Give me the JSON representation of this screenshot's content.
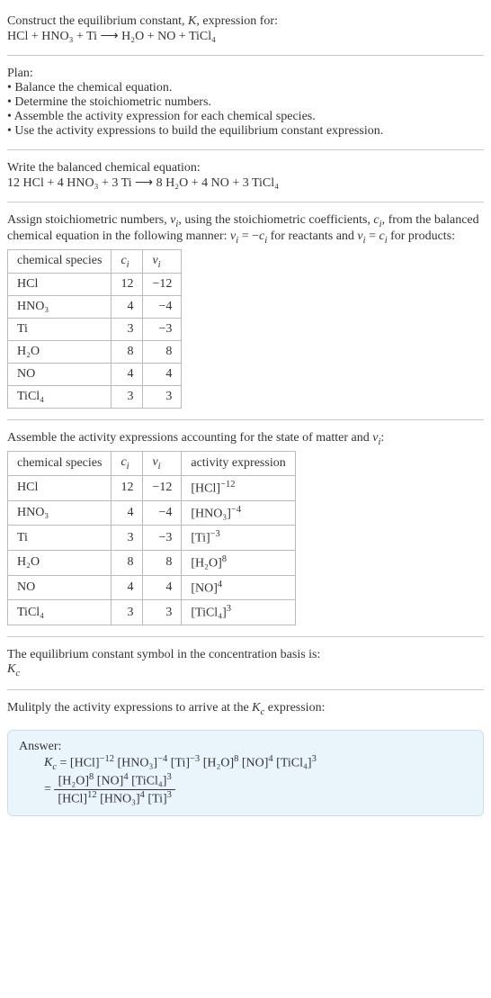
{
  "intro": {
    "line1": "Construct the equilibrium constant, K, expression for:",
    "eq": "HCl + HNO₃ + Ti ⟶ H₂O + NO + TiCl₄"
  },
  "plan": {
    "header": "Plan:",
    "items": [
      "• Balance the chemical equation.",
      "• Determine the stoichiometric numbers.",
      "• Assemble the activity expression for each chemical species.",
      "• Use the activity expressions to build the equilibrium constant expression."
    ]
  },
  "balanced": {
    "header": "Write the balanced chemical equation:",
    "eq": "12 HCl + 4 HNO₃ + 3 Ti ⟶ 8 H₂O + 4 NO + 3 TiCl₄"
  },
  "stoich_intro": {
    "text": "Assign stoichiometric numbers, νᵢ, using the stoichiometric coefficients, cᵢ, from the balanced chemical equation in the following manner: νᵢ = −cᵢ for reactants and νᵢ = cᵢ for products:"
  },
  "table1": {
    "headers": [
      "chemical species",
      "cᵢ",
      "νᵢ"
    ],
    "rows": [
      [
        "HCl",
        "12",
        "−12"
      ],
      [
        "HNO₃",
        "4",
        "−4"
      ],
      [
        "Ti",
        "3",
        "−3"
      ],
      [
        "H₂O",
        "8",
        "8"
      ],
      [
        "NO",
        "4",
        "4"
      ],
      [
        "TiCl₄",
        "3",
        "3"
      ]
    ]
  },
  "activity_intro": "Assemble the activity expressions accounting for the state of matter and νᵢ:",
  "table2": {
    "headers": [
      "chemical species",
      "cᵢ",
      "νᵢ",
      "activity expression"
    ],
    "rows": [
      {
        "species": "HCl",
        "c": "12",
        "v": "−12",
        "expr_base": "[HCl]",
        "expr_exp": "−12"
      },
      {
        "species": "HNO₃",
        "c": "4",
        "v": "−4",
        "expr_base": "[HNO₃]",
        "expr_exp": "−4"
      },
      {
        "species": "Ti",
        "c": "3",
        "v": "−3",
        "expr_base": "[Ti]",
        "expr_exp": "−3"
      },
      {
        "species": "H₂O",
        "c": "8",
        "v": "8",
        "expr_base": "[H₂O]",
        "expr_exp": "8"
      },
      {
        "species": "NO",
        "c": "4",
        "v": "4",
        "expr_base": "[NO]",
        "expr_exp": "4"
      },
      {
        "species": "TiCl₄",
        "c": "3",
        "v": "3",
        "expr_base": "[TiCl₄]",
        "expr_exp": "3"
      }
    ]
  },
  "symbol": {
    "line1": "The equilibrium constant symbol in the concentration basis is:",
    "line2": "K_c"
  },
  "multiply": "Mulitply the activity expressions to arrive at the K_c expression:",
  "answer": {
    "label": "Answer:",
    "line1_prefix": "K_c = ",
    "line1_terms": [
      {
        "base": "[HCl]",
        "exp": "−12"
      },
      {
        "base": "[HNO₃]",
        "exp": "−4"
      },
      {
        "base": "[Ti]",
        "exp": "−3"
      },
      {
        "base": "[H₂O]",
        "exp": "8"
      },
      {
        "base": "[NO]",
        "exp": "4"
      },
      {
        "base": "[TiCl₄]",
        "exp": "3"
      }
    ],
    "eq_sign": "= ",
    "frac_num": [
      {
        "base": "[H₂O]",
        "exp": "8"
      },
      {
        "base": "[NO]",
        "exp": "4"
      },
      {
        "base": "[TiCl₄]",
        "exp": "3"
      }
    ],
    "frac_den": [
      {
        "base": "[HCl]",
        "exp": "12"
      },
      {
        "base": "[HNO₃]",
        "exp": "4"
      },
      {
        "base": "[Ti]",
        "exp": "3"
      }
    ]
  }
}
